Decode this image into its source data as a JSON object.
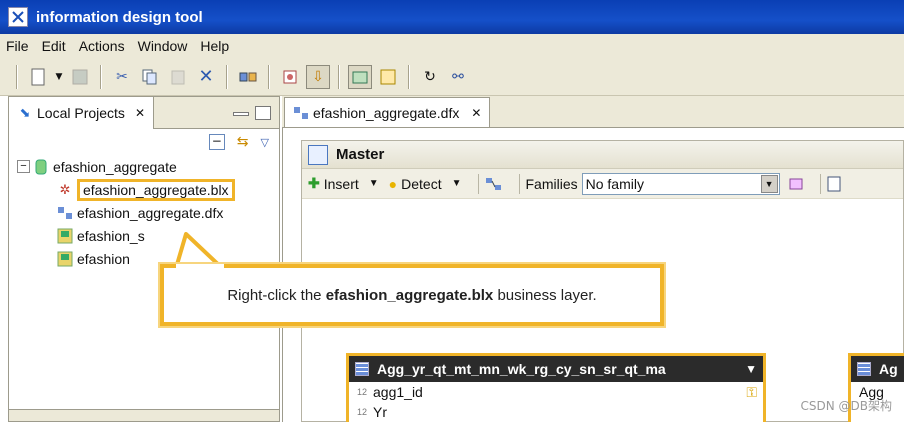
{
  "window": {
    "title": "information design tool"
  },
  "menu": [
    "File",
    "Edit",
    "Actions",
    "Window",
    "Help"
  ],
  "left_panel": {
    "tab_label": "Local Projects",
    "tree": {
      "root": "efashion_aggregate",
      "children": [
        "efashion_aggregate.blx",
        "efashion_aggregate.dfx",
        "efashion_s",
        "efashion"
      ]
    }
  },
  "editor": {
    "tab_label": "efashion_aggregate.dfx",
    "master_title": "Master",
    "toolbar": {
      "insert_label": "Insert",
      "detect_label": "Detect",
      "families_label": "Families",
      "families_value": "No family"
    },
    "tables": [
      {
        "name": "Agg_yr_qt_mt_mn_wk_rg_cy_sn_sr_qt_ma",
        "rows": [
          "agg1_id",
          "Yr"
        ]
      },
      {
        "name": "Ag",
        "rows": [
          "Agg"
        ]
      }
    ]
  },
  "callout": {
    "prefix": "Right-click the",
    "bold": "efashion_aggregate.blx",
    "suffix": "business layer."
  },
  "watermark": "CSDN @DB架构"
}
